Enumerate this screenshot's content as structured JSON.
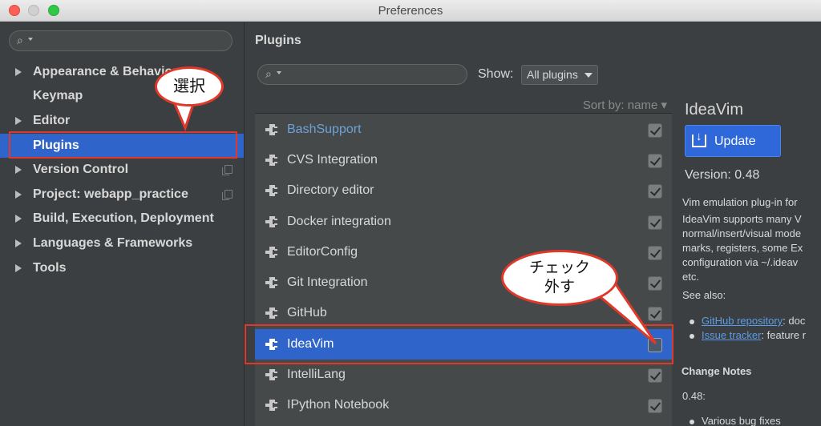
{
  "window": {
    "title": "Preferences"
  },
  "sidebar": {
    "items": [
      {
        "label": "Appearance & Behavior",
        "expandable": true
      },
      {
        "label": "Keymap",
        "expandable": false
      },
      {
        "label": "Editor",
        "expandable": true
      },
      {
        "label": "Plugins",
        "expandable": false,
        "selected": true
      },
      {
        "label": "Version Control",
        "expandable": true
      },
      {
        "label": "Project: webapp_practice",
        "expandable": true
      },
      {
        "label": "Build, Execution, Deployment",
        "expandable": true
      },
      {
        "label": "Languages & Frameworks",
        "expandable": true
      },
      {
        "label": "Tools",
        "expandable": true
      }
    ]
  },
  "annotations": {
    "select_callout": "選択",
    "uncheck_callout": "チェック外す",
    "highlight_color": "#e0392a"
  },
  "main": {
    "title": "Plugins",
    "show_label": "Show:",
    "show_value": "All plugins",
    "sort_label": "Sort by: name",
    "plugins": [
      {
        "name": "BashSupport",
        "checked": true,
        "link_color": true
      },
      {
        "name": "CVS Integration",
        "checked": true
      },
      {
        "name": "Directory editor",
        "checked": true
      },
      {
        "name": "Docker integration",
        "checked": true
      },
      {
        "name": "EditorConfig",
        "checked": true
      },
      {
        "name": "Git Integration",
        "checked": true
      },
      {
        "name": "GitHub",
        "checked": true
      },
      {
        "name": "IdeaVim",
        "checked": false,
        "selected": true
      },
      {
        "name": "IntelliLang",
        "checked": true
      },
      {
        "name": "IPython Notebook",
        "checked": true
      }
    ]
  },
  "detail": {
    "title": "IdeaVim",
    "update_label": "Update",
    "version": "Version: 0.48",
    "desc_1": "Vim emulation plug-in for",
    "desc_2": "IdeaVim supports many V",
    "desc_3": "normal/insert/visual mode",
    "desc_4": "marks, registers, some Ex",
    "desc_5": "configuration via ~/.ideav",
    "desc_6": "etc.",
    "see_also": "See also:",
    "link_1": "GitHub repository",
    "link_1_suffix": ": doc",
    "link_2": "Issue tracker",
    "link_2_suffix": ": feature r",
    "change_notes": "Change Notes",
    "cn_version": "0.48:",
    "cn_item": "Various bug fixes"
  }
}
